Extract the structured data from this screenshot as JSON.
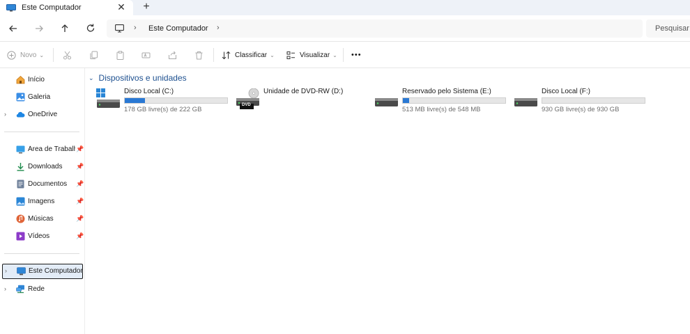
{
  "tab": {
    "title": "Este Computador",
    "close": "✕",
    "new_tab": "+"
  },
  "address": {
    "location": "Este Computador",
    "separator": "›",
    "search_placeholder": "Pesquisar em"
  },
  "toolbar": {
    "new_label": "Novo",
    "sort_label": "Classificar",
    "view_label": "Visualizar",
    "more_label": "•••"
  },
  "sidebar": {
    "top_items": [
      {
        "label": "Início",
        "icon": "home-icon"
      },
      {
        "label": "Galeria",
        "icon": "gallery-icon"
      },
      {
        "label": "OneDrive",
        "icon": "onedrive-icon"
      }
    ],
    "pinned_items": [
      {
        "label": "Área de Trabalho",
        "icon": "desktop-icon"
      },
      {
        "label": "Downloads",
        "icon": "downloads-icon"
      },
      {
        "label": "Documentos",
        "icon": "documents-icon"
      },
      {
        "label": "Imagens",
        "icon": "pictures-icon"
      },
      {
        "label": "Músicas",
        "icon": "music-icon"
      },
      {
        "label": "Vídeos",
        "icon": "videos-icon"
      }
    ],
    "bottom_items": [
      {
        "label": "Este Computador",
        "icon": "this-pc-icon",
        "selected": true
      },
      {
        "label": "Rede",
        "icon": "network-icon"
      }
    ]
  },
  "content": {
    "group_title": "Dispositivos e unidades",
    "drives": [
      {
        "name": "Disco Local (C:)",
        "size_text": "178 GB livre(s) de 222 GB",
        "used_fraction": 0.198,
        "icon": "system-drive-icon"
      },
      {
        "name": "Unidade de DVD-RW (D:)",
        "size_text": "",
        "used_fraction": null,
        "icon": "dvd-drive-icon",
        "badge": "DVD"
      },
      {
        "name": "Reservado pelo Sistema (E:)",
        "size_text": "513 MB livre(s) de 548 MB",
        "used_fraction": 0.064,
        "icon": "hard-drive-icon"
      },
      {
        "name": "Disco Local (F:)",
        "size_text": "930 GB livre(s) de 930 GB",
        "used_fraction": 0.0,
        "icon": "hard-drive-icon"
      }
    ]
  },
  "colors": {
    "accent": "#2a79d4",
    "group_title": "#1c4f8f",
    "selected_bg": "#e3ecf7"
  }
}
